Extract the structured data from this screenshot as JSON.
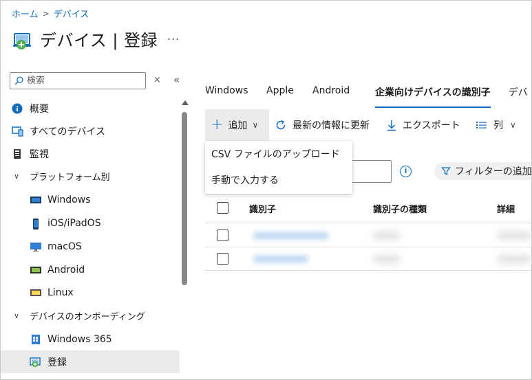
{
  "breadcrumb": {
    "home": "ホーム",
    "separator": ">",
    "current": "デバイス"
  },
  "header": {
    "title": "デバイス | 登録",
    "more": "..."
  },
  "search": {
    "placeholder": "検索",
    "clear": "×",
    "collapse": "«"
  },
  "sidebar": {
    "items": [
      {
        "label": "概要",
        "icon": "info-icon"
      },
      {
        "label": "すべてのデバイス",
        "icon": "devices-icon"
      },
      {
        "label": "監視",
        "icon": "monitor-notebook-icon"
      },
      {
        "label": "プラットフォーム別",
        "icon": "chevron-down-icon"
      },
      {
        "label": "Windows",
        "icon": "windows-device-icon"
      },
      {
        "label": "iOS/iPadOS",
        "icon": "phone-icon"
      },
      {
        "label": "macOS",
        "icon": "desktop-icon"
      },
      {
        "label": "Android",
        "icon": "android-device-icon"
      },
      {
        "label": "Linux",
        "icon": "linux-device-icon"
      },
      {
        "label": "デバイスのオンボーディング",
        "icon": "chevron-down-icon"
      },
      {
        "label": "Windows 365",
        "icon": "windows365-icon"
      },
      {
        "label": "登録",
        "icon": "enrollment-icon"
      }
    ]
  },
  "tabs": [
    "Windows",
    "Apple",
    "Android",
    "企業向けデバイスの識別子",
    "デバ"
  ],
  "toolbar": {
    "add": "追加",
    "refresh": "最新の情報に更新",
    "export": "エクスポート",
    "columns": "列"
  },
  "dropdown": {
    "options": [
      "CSV ファイルのアップロード",
      "手動で入力する"
    ]
  },
  "filter": {
    "add_filter": "フィルターの追加"
  },
  "table": {
    "columns": [
      "識別子",
      "識別子の種類",
      "詳細"
    ],
    "row_count": 2
  },
  "colors": {
    "accent": "#0f6cbd",
    "selected_bg": "#ebebeb"
  }
}
